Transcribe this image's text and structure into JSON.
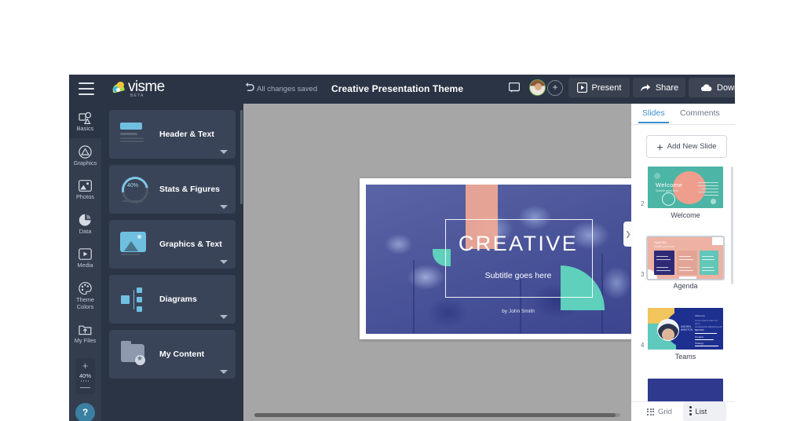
{
  "app": {
    "brand": "visme",
    "brand_sub": "BETA",
    "save_status": "All changes saved",
    "document_title": "Creative Presentation Theme"
  },
  "topbar": {
    "menu_icon": "hamburger-icon",
    "undo_icon": "undo-icon",
    "comment_icon": "comment-icon",
    "avatar_label": "user-avatar",
    "add_people_icon": "add-person-icon",
    "present_label": "Present",
    "share_label": "Share",
    "download_label": "Download"
  },
  "rail": {
    "items": [
      {
        "label": "Basics",
        "icon": "basics-icon",
        "active": true
      },
      {
        "label": "Graphics",
        "icon": "graphics-icon",
        "active": false
      },
      {
        "label": "Photos",
        "icon": "photos-icon",
        "active": false
      },
      {
        "label": "Data",
        "icon": "data-pie-icon",
        "active": false
      },
      {
        "label": "Media",
        "icon": "media-icon",
        "active": false
      },
      {
        "label": "Theme Colors",
        "icon": "palette-icon",
        "active": false
      },
      {
        "label": "My Files",
        "icon": "my-files-icon",
        "active": false
      }
    ],
    "zoom": {
      "plus": "+",
      "value": "40%",
      "minus": "—"
    },
    "help_label": "?"
  },
  "content_panel": {
    "cards": [
      {
        "title": "Header & Text",
        "icon": "header-text-thumb"
      },
      {
        "title": "Stats & Figures",
        "icon": "stats-ring-thumb",
        "ring_value": "40%"
      },
      {
        "title": "Graphics & Text",
        "icon": "graphics-text-thumb"
      },
      {
        "title": "Diagrams",
        "icon": "diagrams-thumb"
      },
      {
        "title": "My Content",
        "icon": "my-content-folder-thumb"
      }
    ]
  },
  "slide": {
    "title": "CREATIVE",
    "subtitle": "Subtitle goes here",
    "byline": "by John Smith",
    "colors": {
      "salmon": "#f0a995",
      "teal": "#5fd0bc",
      "background_blue": "#4c5596",
      "frame": "#ffffff"
    }
  },
  "right_panel": {
    "tabs": [
      {
        "label": "Slides",
        "selected": true
      },
      {
        "label": "Comments",
        "selected": false
      }
    ],
    "add_slide_label": "Add New Slide",
    "collapse_icon": "chevron-right-icon",
    "slides": [
      {
        "number": "2",
        "label": "Welcome"
      },
      {
        "number": "3",
        "label": "Agenda"
      },
      {
        "number": "4",
        "label": "Teams"
      }
    ],
    "footer": {
      "grid_label": "Grid",
      "list_label": "List",
      "grid_icon": "grid-icon",
      "list_icon": "list-icon"
    }
  }
}
